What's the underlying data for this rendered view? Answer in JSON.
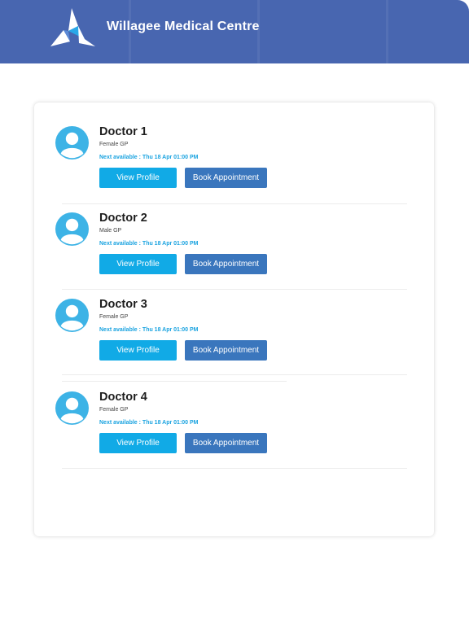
{
  "header": {
    "title": "Willagee Medical Centre",
    "logo_icon": "triangle-logo-icon",
    "bg_color": "#4866b0"
  },
  "doctors": [
    {
      "name": "Doctor 1",
      "role": "Female GP",
      "next_available": "Next available : Thu 18 Apr 01:00 PM",
      "view_label": "View Profile",
      "book_label": "Book Appointment"
    },
    {
      "name": "Doctor 2",
      "role": "Male GP",
      "next_available": "Next available : Thu 18 Apr 01:00 PM",
      "view_label": "View Profile",
      "book_label": "Book Appointment"
    },
    {
      "name": "Doctor 3",
      "role": "Female GP",
      "next_available": "Next available : Thu 18 Apr 01:00 PM",
      "view_label": "View Profile",
      "book_label": "Book Appointment"
    },
    {
      "name": "Doctor 4",
      "role": "Female GP",
      "next_available": "Next available : Thu 18 Apr 01:00 PM",
      "view_label": "View Profile",
      "book_label": "Book Appointment"
    }
  ],
  "colors": {
    "view_button": "#11aae6",
    "book_button": "#3a76bd",
    "next_available_text": "#1aa3e0",
    "avatar": "#3db3e6"
  }
}
